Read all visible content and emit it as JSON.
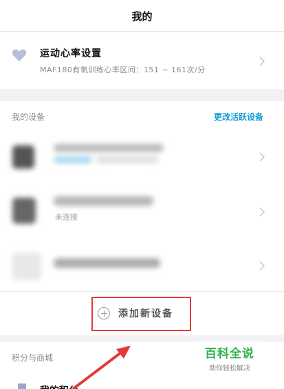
{
  "header": {
    "title": "我的"
  },
  "heart_rate": {
    "title": "运动心率设置",
    "subtitle": "MAF180有氧训练心率区间：151 ~ 161次/分"
  },
  "devices": {
    "section_title": "我的设备",
    "change_link": "更改活跃设备",
    "items": [
      {
        "status": ""
      },
      {
        "status": "未连接"
      },
      {
        "status": ""
      }
    ],
    "add_button": "添加新设备"
  },
  "shop": {
    "section_title": "积分与商城",
    "item_label": "我的积分"
  },
  "watermark": {
    "title": "百科全说",
    "subtitle": "助你轻松解决"
  },
  "colors": {
    "accent_blue": "#1a9bd7",
    "highlight_red": "#e23a3a",
    "brand_green": "#2db34a"
  }
}
